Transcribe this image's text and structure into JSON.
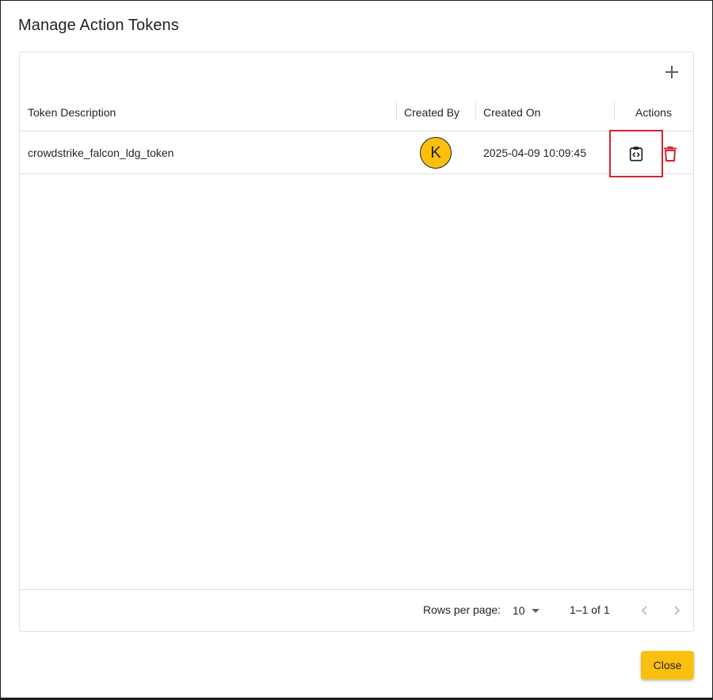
{
  "dialog": {
    "title": "Manage Action Tokens",
    "close_label": "Close"
  },
  "table": {
    "columns": {
      "description": "Token Description",
      "created_by": "Created By",
      "created_on": "Created On",
      "actions": "Actions"
    },
    "rows": [
      {
        "description": "crowdstrike_falcon_ldg_token",
        "created_by_initial": "K",
        "created_on": "2025-04-09 10:09:45"
      }
    ]
  },
  "pagination": {
    "rows_per_page_label": "Rows per page:",
    "rows_per_page_value": "10",
    "range": "1–1 of 1"
  },
  "colors": {
    "accent": "#fbbf0e",
    "danger": "#d6232c",
    "highlight": "#d6232c"
  },
  "icons": {
    "add": "plus-icon",
    "copy": "clipboard-code-icon",
    "delete": "trash-icon",
    "dropdown": "caret-down-icon",
    "prev": "chevron-left-icon",
    "next": "chevron-right-icon"
  }
}
